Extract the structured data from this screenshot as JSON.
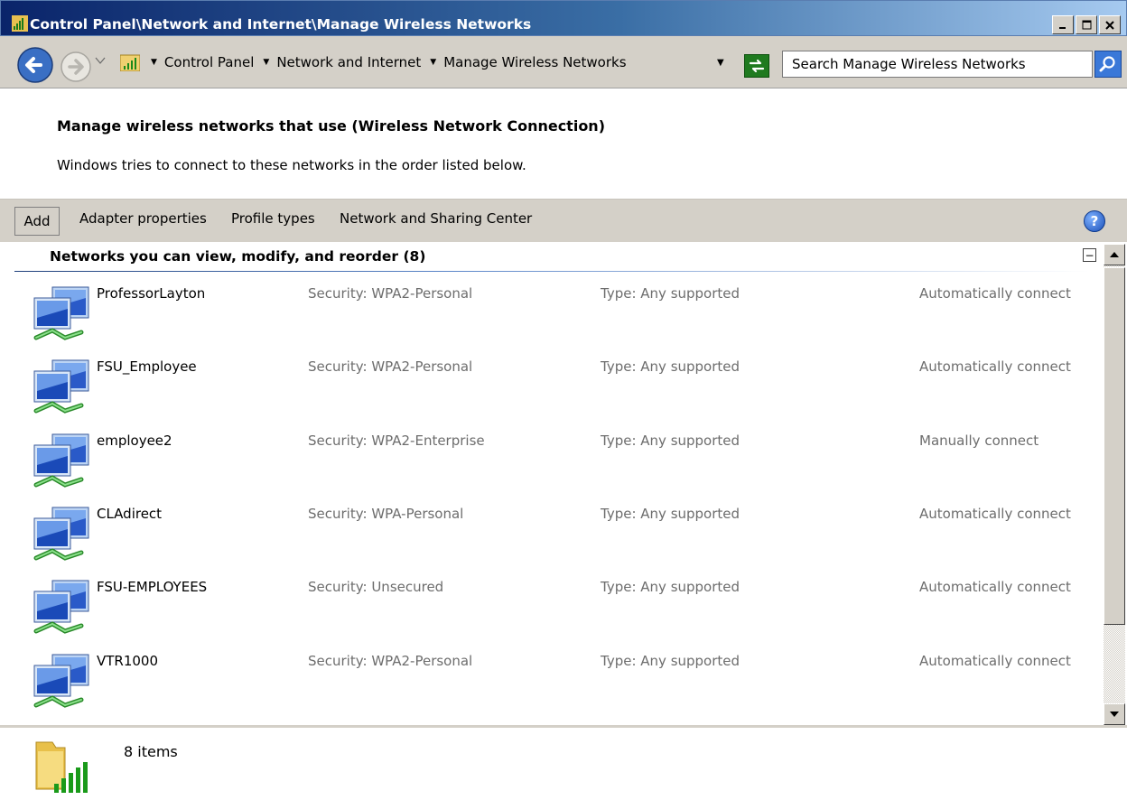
{
  "window": {
    "title": "Control Panel\\Network and Internet\\Manage Wireless Networks",
    "controls": [
      "minimize",
      "maximize",
      "close"
    ]
  },
  "address_bar": {
    "breadcrumbs": [
      "Control Panel",
      "Network and Internet",
      "Manage Wireless Networks"
    ],
    "search_placeholder": "Search Manage Wireless Networks"
  },
  "header": {
    "title": "Manage wireless networks that use (Wireless Network Connection)",
    "subtitle": "Windows tries to connect to these networks in the order listed below."
  },
  "toolbar": {
    "add_label": "Add",
    "adapter_label": "Adapter properties",
    "profile_label": "Profile types",
    "sharing_label": "Network and Sharing Center",
    "help_icon": "help-icon"
  },
  "group": {
    "title": "Networks you can view, modify, and reorder (8)"
  },
  "networks": [
    {
      "name": "ProfessorLayton",
      "security": "Security:  WPA2-Personal",
      "type": "Type:  Any supported",
      "mode": "Automatically connect"
    },
    {
      "name": "FSU_Employee",
      "security": "Security:  WPA2-Personal",
      "type": "Type:  Any supported",
      "mode": "Automatically connect"
    },
    {
      "name": "employee2",
      "security": "Security:  WPA2-Enterprise",
      "type": "Type:  Any supported",
      "mode": "Manually connect"
    },
    {
      "name": "CLAdirect",
      "security": "Security:  WPA-Personal",
      "type": "Type:  Any supported",
      "mode": "Automatically connect"
    },
    {
      "name": "FSU-EMPLOYEES",
      "security": "Security:  Unsecured",
      "type": "Type:  Any supported",
      "mode": "Automatically connect"
    },
    {
      "name": "VTR1000",
      "security": "Security:  WPA2-Personal",
      "type": "Type:  Any supported",
      "mode": "Automatically connect"
    }
  ],
  "details": {
    "count": "8 items"
  },
  "colors": {
    "title_gradient_start": "#0a246a",
    "chrome": "#d4d0c8",
    "secondary_text": "#6d6d6d"
  }
}
